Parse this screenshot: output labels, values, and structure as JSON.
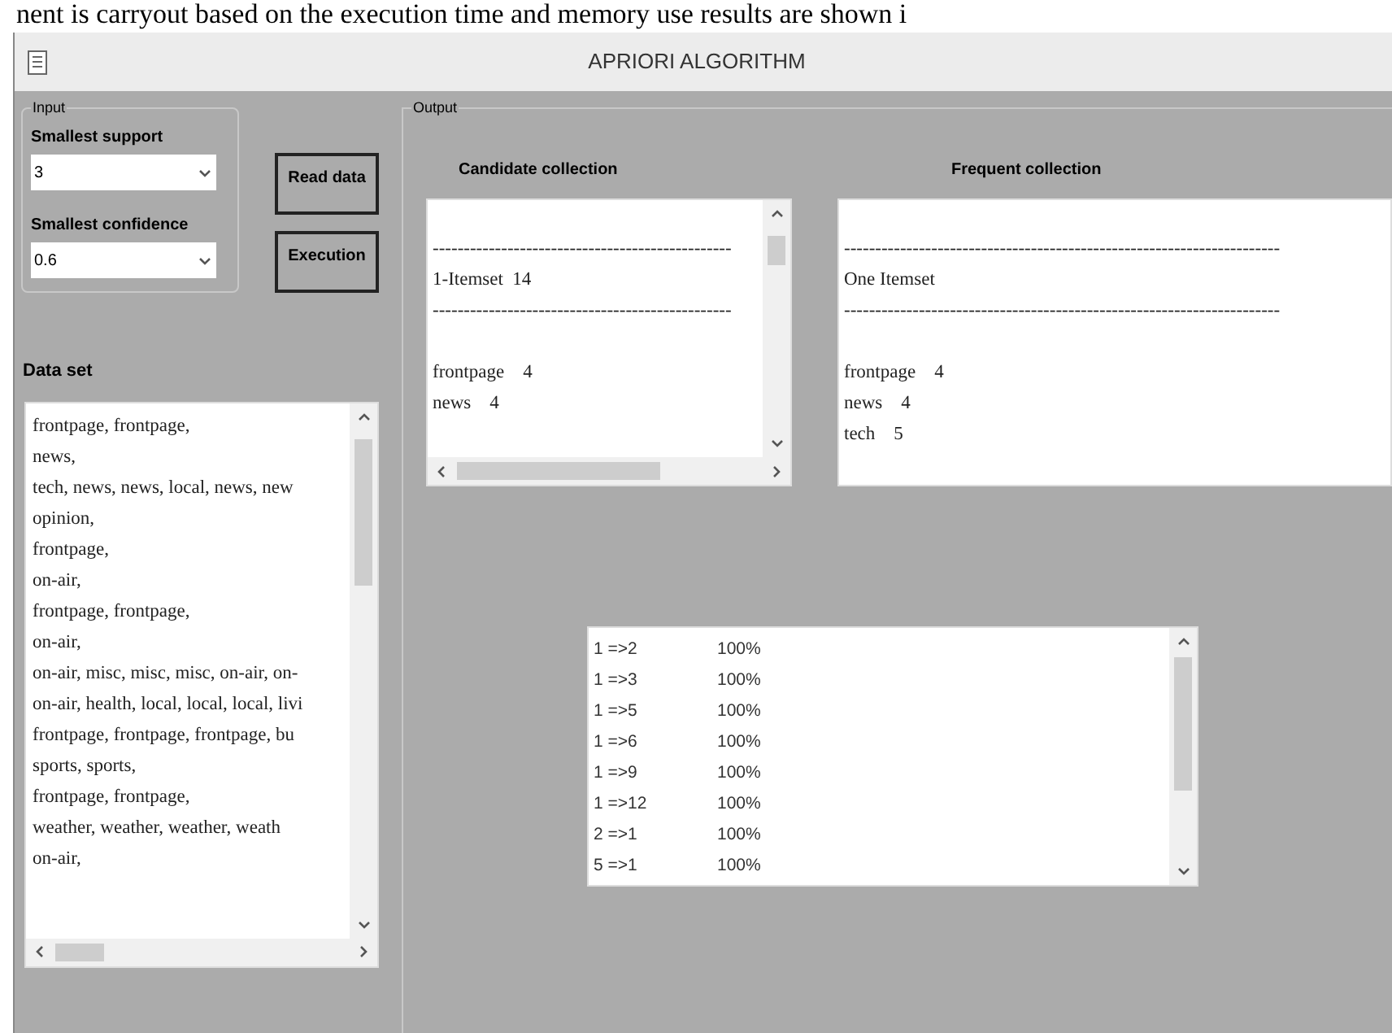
{
  "page_text": "nent is carryout based on the execution time and memory use results are shown i",
  "window": {
    "title": "APRIORI ALGORITHM"
  },
  "input_group": {
    "title": "Input",
    "fields": [
      {
        "label": "Smallest support",
        "value": "3"
      },
      {
        "label": "Smallest confidence",
        "value": "0.6"
      }
    ]
  },
  "buttons": [
    {
      "label": "Read data"
    },
    {
      "label": "Execution"
    }
  ],
  "data_set": {
    "label": "Data set",
    "lines": [
      "frontpage, frontpage,",
      "news,",
      "tech, news, news, local, news, new",
      "opinion,",
      "frontpage,",
      "on-air,",
      "frontpage, frontpage,",
      "on-air,",
      "on-air, misc, misc, misc, on-air, on-",
      "on-air, health, local, local, local, livi",
      "frontpage, frontpage, frontpage, bu",
      "sports, sports,",
      "frontpage, frontpage,",
      "weather, weather, weather, weath",
      "on-air,"
    ]
  },
  "output_group": {
    "title": "Output",
    "candidate": {
      "label": "Candidate collection",
      "lines": [
        {
          "kind": "separator",
          "text": "------------------------------------------------"
        },
        {
          "kind": "heading",
          "text": "1-Itemset  14"
        },
        {
          "kind": "separator",
          "text": "------------------------------------------------"
        },
        {
          "kind": "item",
          "text": "frontpage    4"
        },
        {
          "kind": "item",
          "text": "news    4"
        }
      ]
    },
    "frequent": {
      "label": "Frequent collection",
      "lines": [
        {
          "kind": "separator",
          "text": "----------------------------------------------------------------------"
        },
        {
          "kind": "heading",
          "text": "One Itemset"
        },
        {
          "kind": "separator",
          "text": "----------------------------------------------------------------------"
        },
        {
          "kind": "item",
          "text": "frontpage    4"
        },
        {
          "kind": "item",
          "text": "news    4"
        },
        {
          "kind": "item",
          "text": "tech    5"
        }
      ]
    },
    "rules": [
      {
        "rule": "1 =>2",
        "confidence": "100%"
      },
      {
        "rule": "1 =>3",
        "confidence": "100%"
      },
      {
        "rule": "1 =>5",
        "confidence": "100%"
      },
      {
        "rule": "1 =>6",
        "confidence": "100%"
      },
      {
        "rule": "1 =>9",
        "confidence": "100%"
      },
      {
        "rule": "1 =>12",
        "confidence": "100%"
      },
      {
        "rule": "2 =>1",
        "confidence": "100%"
      },
      {
        "rule": "5 =>1",
        "confidence": "100%"
      }
    ]
  }
}
